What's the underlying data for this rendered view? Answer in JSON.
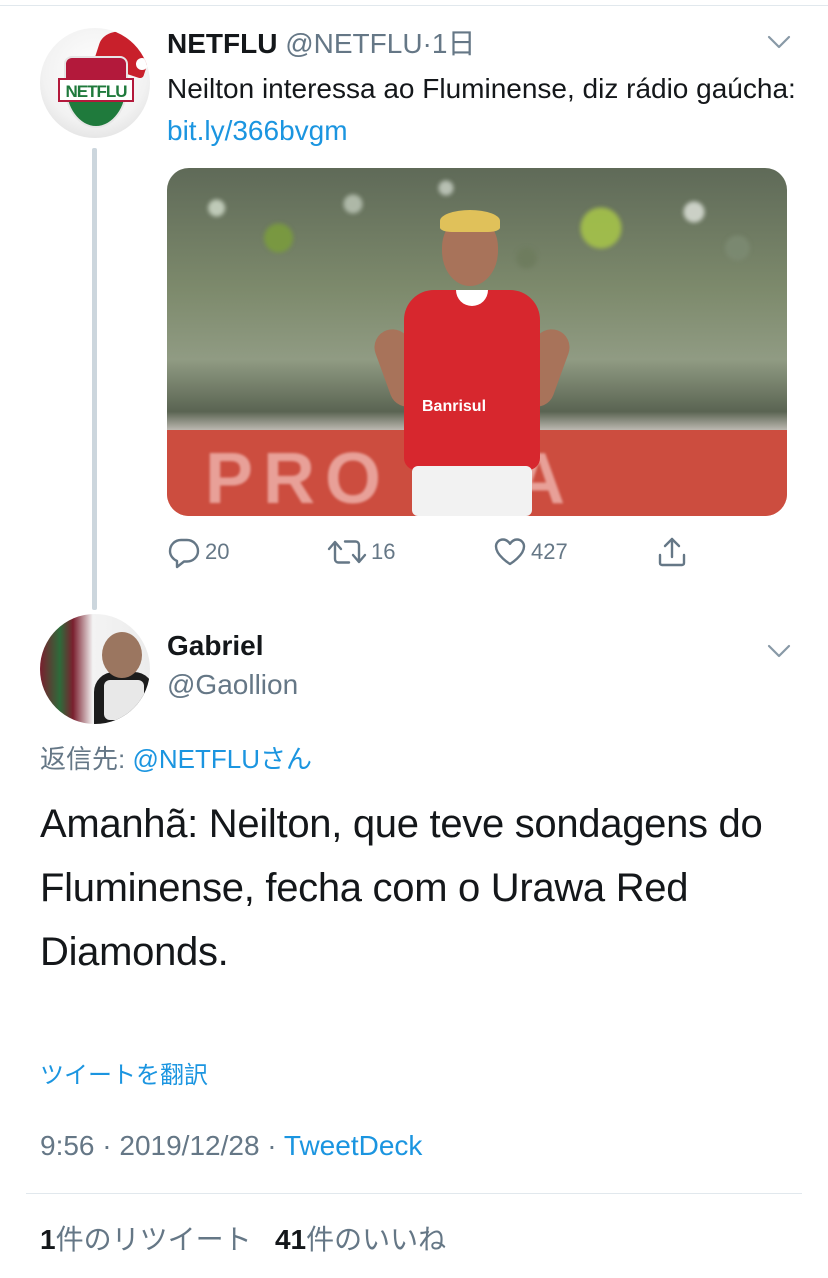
{
  "parent_tweet": {
    "name": "NETFLU",
    "handle": "@NETFLU",
    "time_sep": "·",
    "time": "1日",
    "avatar_text": "NETFLU",
    "text": "Neilton interessa ao Fluminense, diz rádio gaúcha: ",
    "link": "bit.ly/366bvgm",
    "media": {
      "board_text": "PRO IDA",
      "sponsor": "Banrisul"
    },
    "actions": {
      "replies": "20",
      "retweets": "16",
      "likes": "427"
    }
  },
  "reply_tweet": {
    "name": "Gabriel",
    "handle": "@Gaollion",
    "replying_to_label": "返信先: ",
    "replying_to_mention": "@NETFLU",
    "replying_to_suffix": "さん",
    "text": "Amanhã: Neilton, que teve sondagens do Fluminense, fecha com o Urawa Red Diamonds.",
    "translate_label": "ツイートを翻訳",
    "timestamp": "9:56 · 2019/12/28 · ",
    "source": "TweetDeck",
    "retweet_count": "1",
    "retweet_label": "件のリツイート",
    "like_count": "41",
    "like_label": "件のいいね"
  },
  "colors": {
    "link": "#1b95e0",
    "secondary_text": "#657786",
    "primary_text": "#14171a"
  },
  "icons": [
    "chevron-down-icon",
    "reply-icon",
    "retweet-icon",
    "like-icon",
    "share-icon"
  ]
}
